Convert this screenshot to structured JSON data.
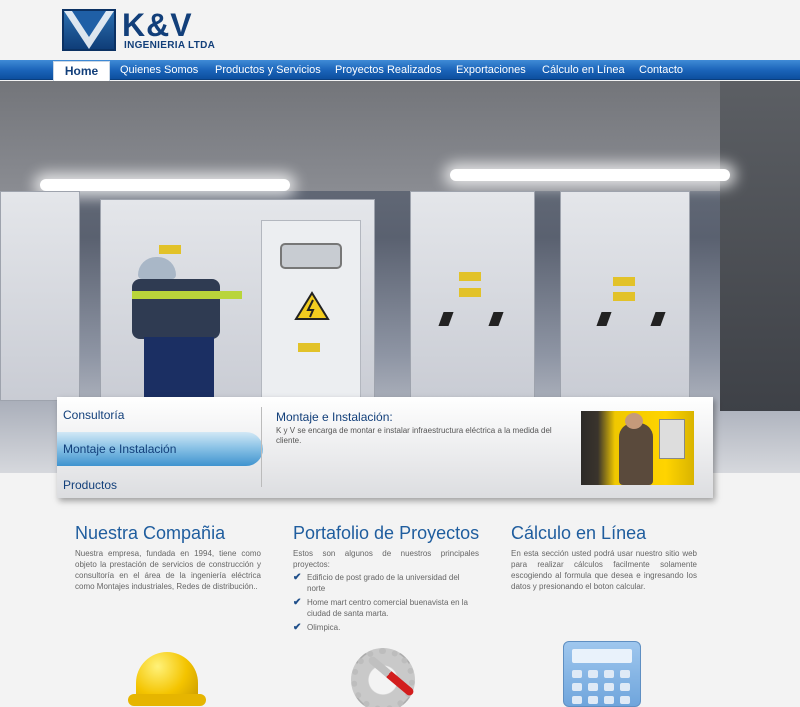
{
  "brand": {
    "name": "K&V",
    "subtitle": "INGENIERIA LTDA"
  },
  "nav": {
    "items": [
      {
        "label": "Home",
        "active": true
      },
      {
        "label": "Quienes Somos"
      },
      {
        "label": "Productos y Servicios"
      },
      {
        "label": "Proyectos Realizados"
      },
      {
        "label": "Exportaciones"
      },
      {
        "label": "Cálculo en Línea"
      },
      {
        "label": "Contacto"
      }
    ]
  },
  "slider": {
    "tabs": [
      {
        "label": "Consultoría"
      },
      {
        "label": "Montaje e Instalación",
        "active": true
      },
      {
        "label": "Productos"
      }
    ],
    "title": "Montaje e Instalación:",
    "text": "K y V se encarga de montar e instalar infraestructura eléctrica a la medida del cliente."
  },
  "columns": [
    {
      "title": "Nuestra Compañia",
      "text": "Nuestra empresa, fundada en 1994, tiene como objeto la prestación de servicios de construcción y consultoría en el área de la ingeniería eléctrica como Montajes industriales, Redes de distribución.."
    },
    {
      "title": "Portafolio de Proyectos",
      "text": "Estos son algunos de nuestros principales proyectos:",
      "items": [
        "Edificio de post grado de la universidad del norte",
        "Home mart centro comercial buenavista en la ciudad de santa marta.",
        "Olimpica."
      ]
    },
    {
      "title": "Cálculo en Línea",
      "text": "En esta sección usted podrá usar nuestro sitio web para realizar cálculos facilmente solamente escogiendo al formula que desea e ingresando los datos y presionando el boton calcular."
    }
  ],
  "icons": {
    "check": "✔",
    "helmet": "helmet-icon",
    "gear": "gear-tool-icon",
    "calculator": "calculator-icon"
  },
  "colors": {
    "nav_blue": "#1a63b8",
    "title_blue": "#1f5d9e",
    "brand_blue": "#123f7a"
  }
}
